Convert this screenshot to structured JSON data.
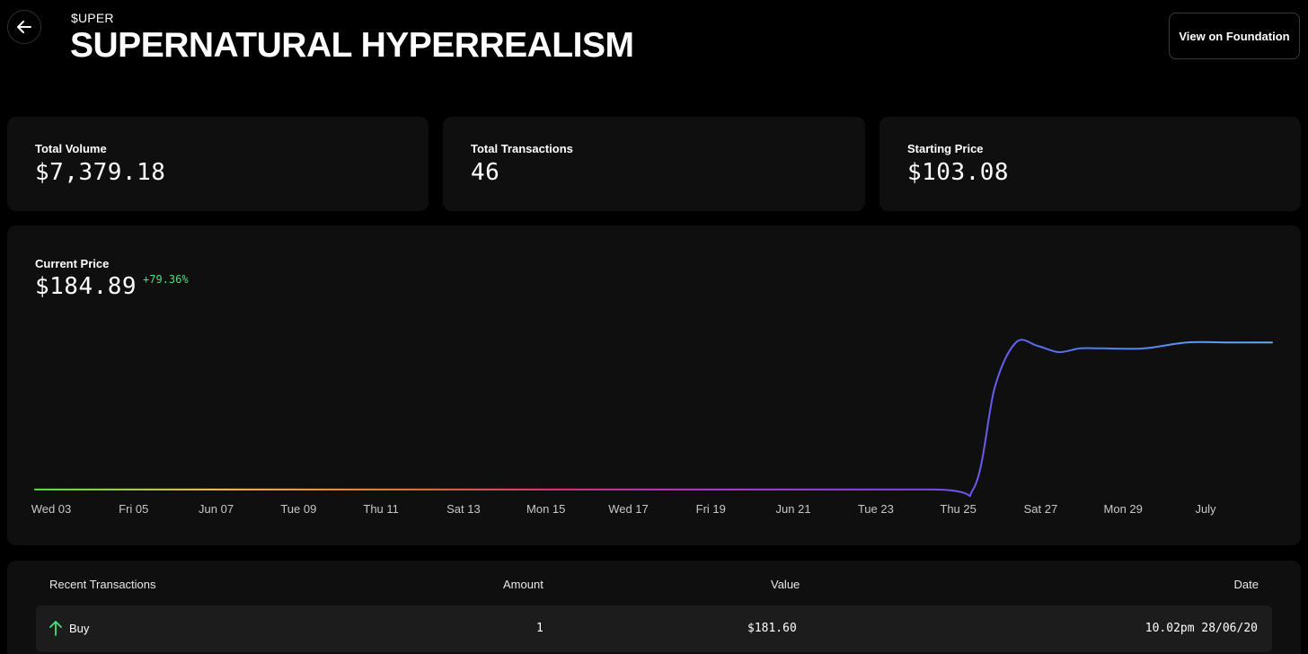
{
  "header": {
    "ticker": "$UPER",
    "title": "SUPERNATURAL HYPERREALISM",
    "foundation_button": "View on Foundation",
    "back_icon": "arrow-left-icon"
  },
  "stats": [
    {
      "label": "Total Volume",
      "value": "$7,379.18"
    },
    {
      "label": "Total Transactions",
      "value": "46"
    },
    {
      "label": "Starting Price",
      "value": "$103.08"
    }
  ],
  "current_price": {
    "label": "Current Price",
    "value": "$184.89",
    "change": "+79.36%",
    "change_color": "#4ade80"
  },
  "chart_data": {
    "type": "line",
    "x_tick_labels": [
      "Wed 03",
      "Fri 05",
      "Jun 07",
      "Tue 09",
      "Thu 11",
      "Sat 13",
      "Mon 15",
      "Wed 17",
      "Fri 19",
      "Jun 21",
      "Tue 23",
      "Thu 25",
      "Sat 27",
      "Mon 29",
      "July"
    ],
    "x": [
      "2020-06-03",
      "2020-06-10",
      "2020-06-17",
      "2020-06-24",
      "2020-06-25",
      "2020-06-25T12:00",
      "2020-06-26",
      "2020-06-26T12:00",
      "2020-06-27",
      "2020-06-27T12:00",
      "2020-06-28",
      "2020-06-29",
      "2020-06-30",
      "2020-07-01",
      "2020-07-02"
    ],
    "values": [
      103.08,
      103.08,
      103.08,
      103.08,
      103.5,
      160,
      185,
      183,
      179.5,
      181.6,
      181.6,
      181.6,
      184.89,
      184.89,
      184.89
    ],
    "gradient_colors": [
      "#5ee04a",
      "#f2c94c",
      "#f07a3a",
      "#e0307a",
      "#a040e0",
      "#7a46f0",
      "#4a7ef0",
      "#66aaf5"
    ],
    "grid": false,
    "legend": "none"
  },
  "transactions": {
    "headers": {
      "title": "Recent Transactions",
      "amount": "Amount",
      "value": "Value",
      "date": "Date"
    },
    "rows": [
      {
        "type": "Buy",
        "icon": "arrow-up-icon",
        "amount": "1",
        "value": "$181.60",
        "date": "10.02pm 28/06/20"
      }
    ]
  }
}
